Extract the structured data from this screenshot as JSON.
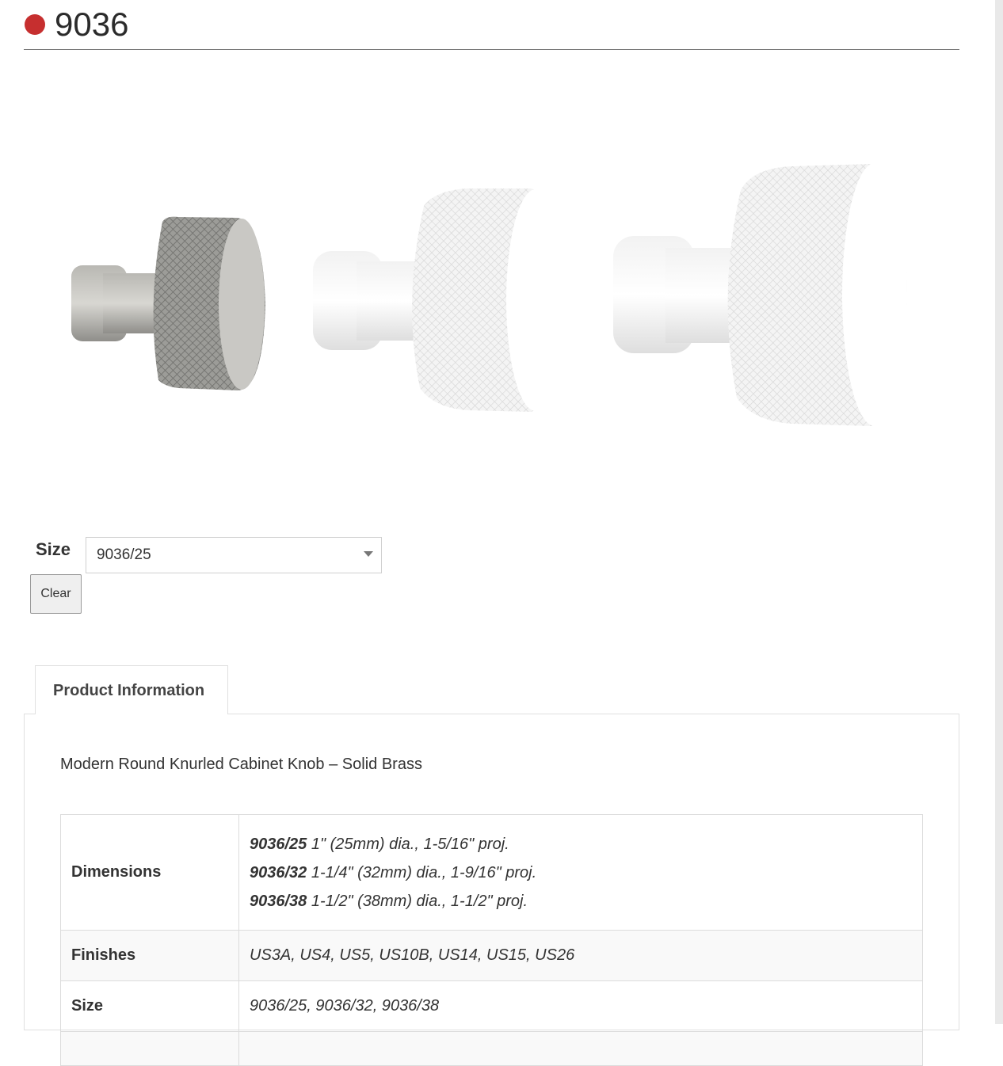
{
  "product": {
    "title": "9036",
    "accent_color": "#c62f2f"
  },
  "gallery": {
    "images": [
      "satin-nickel-knob",
      "white-knob-medium",
      "white-knob-large"
    ]
  },
  "variation": {
    "label": "Size",
    "selected": "9036/25",
    "clear_label": "Clear"
  },
  "tabs": [
    {
      "label": "Product Information"
    }
  ],
  "info": {
    "description": "Modern Round Knurled Cabinet Knob – Solid Brass",
    "table": {
      "dimensions_label": "Dimensions",
      "dimensions": [
        {
          "code": "9036/25",
          "text": "1\" (25mm) dia., 1-5/16\" proj."
        },
        {
          "code": "9036/32",
          "text": "1-1/4\" (32mm) dia., 1-9/16\" proj."
        },
        {
          "code": "9036/38",
          "text": "1-1/2\" (38mm) dia., 1-1/2\" proj."
        }
      ],
      "finishes_label": "Finishes",
      "finishes": "US3A, US4, US5, US10B, US14, US15, US26",
      "size_label": "Size",
      "sizes": "9036/25, 9036/32, 9036/38"
    }
  }
}
